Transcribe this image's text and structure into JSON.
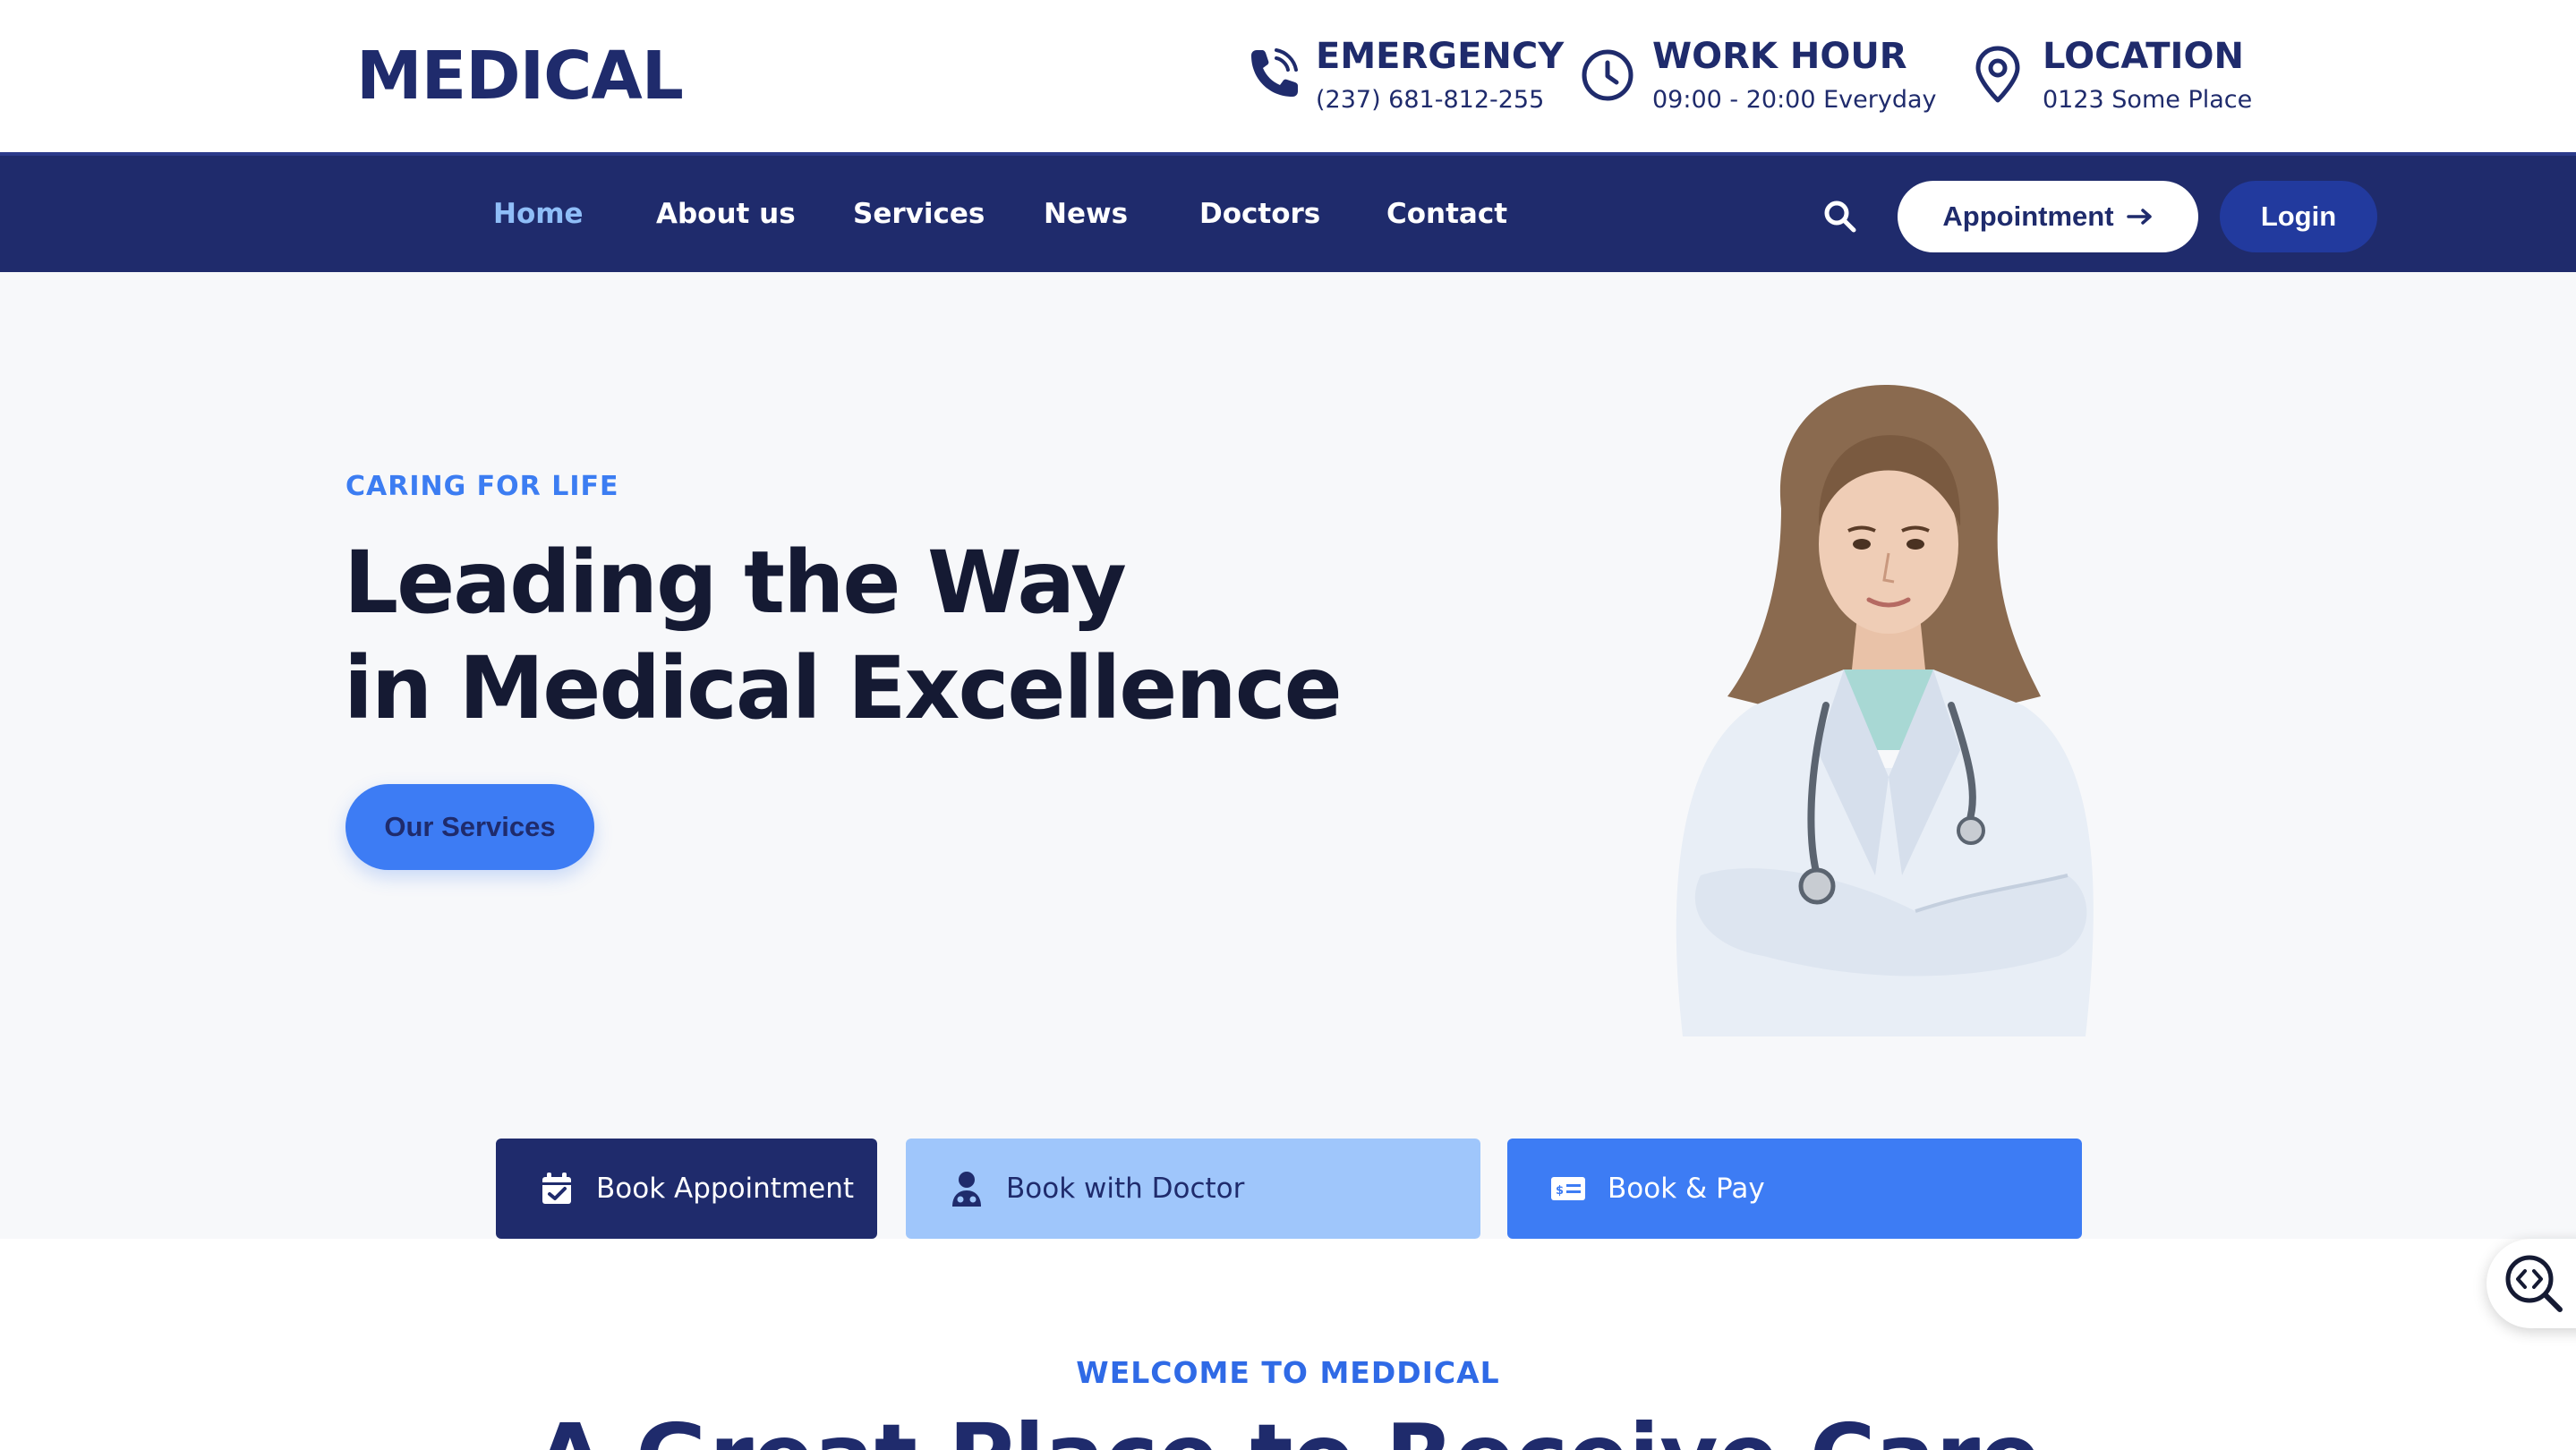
{
  "header": {
    "logo": "MEDICAL",
    "emergency": {
      "title": "EMERGENCY",
      "value": "(237) 681-812-255",
      "icon": "phone-icon"
    },
    "work_hour": {
      "title": "WORK HOUR",
      "value": "09:00 - 20:00 Everyday",
      "icon": "clock-icon"
    },
    "location": {
      "title": "LOCATION",
      "value": "0123 Some Place",
      "icon": "map-pin-icon"
    }
  },
  "nav": {
    "items": [
      {
        "label": "Home",
        "active": true
      },
      {
        "label": "About us"
      },
      {
        "label": "Services"
      },
      {
        "label": "News"
      },
      {
        "label": "Doctors"
      },
      {
        "label": "Contact"
      }
    ],
    "search_icon": "search-icon",
    "appointment_label": "Appointment",
    "login_label": "Login"
  },
  "hero": {
    "eyebrow": "CARING FOR LIFE",
    "headline_line1": "Leading the Way",
    "headline_line2": "in Medical Excellence",
    "cta_label": "Our Services"
  },
  "actions": [
    {
      "label": "Book Appointment",
      "icon": "calendar-check-icon"
    },
    {
      "label": "Book with Doctor",
      "icon": "doctor-icon"
    },
    {
      "label": "Book & Pay",
      "icon": "payment-card-icon"
    }
  ],
  "welcome": {
    "eyebrow": "WELCOME TO MEDDICAL",
    "title": "A Great Place to Receive Care"
  },
  "colors": {
    "primary": "#1f2b6c",
    "accent": "#3d7cf4",
    "light_accent": "#9fc6fb",
    "nav_active": "#8fbef8",
    "hero_bg": "#f7f8fa"
  }
}
